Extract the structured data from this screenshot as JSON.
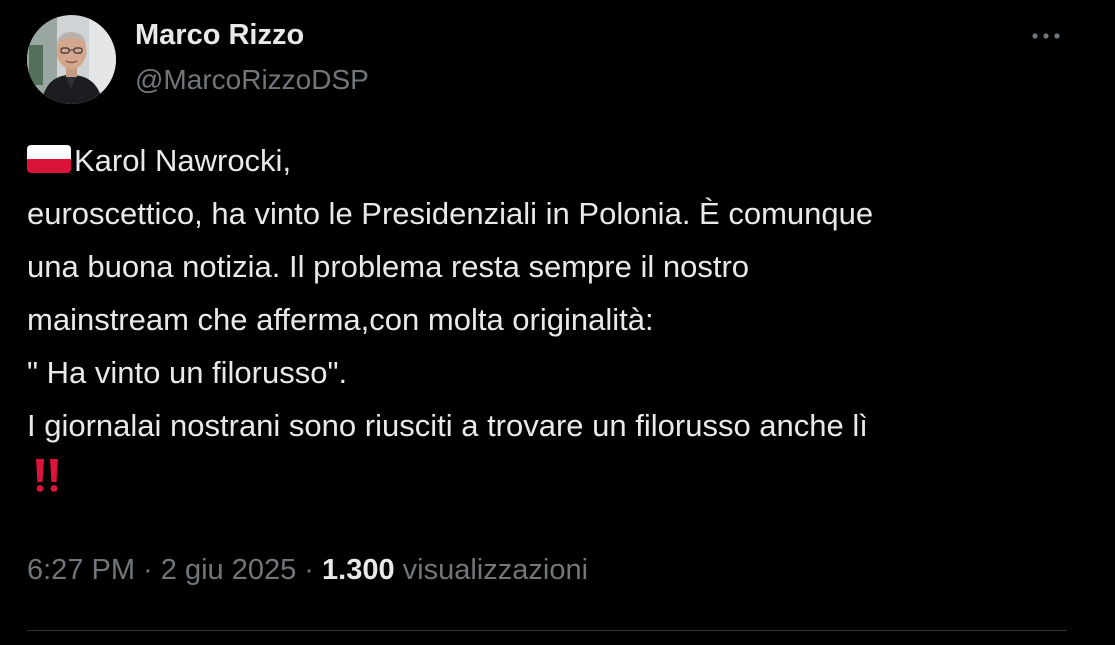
{
  "author": {
    "name": "Marco Rizzo",
    "handle": "@MarcoRizzoDSP",
    "avatar_icon": "profile-photo"
  },
  "more_icon": "more-horizontal-icon",
  "tweet": {
    "lines": [
      "Karol Nawrocki,",
      "euroscettico, ha vinto le Presidenziali in Polonia. È comunque",
      "una buona notizia. Il problema resta sempre il nostro",
      "mainstream che afferma,con molta originalità:",
      "\" Ha vinto un filorusso\".",
      "I giornalai nostrani sono riusciti a trovare un filorusso anche lì"
    ],
    "leading_emoji": "poland-flag-icon",
    "trailing_emoji": "double-exclamation-icon"
  },
  "meta": {
    "time": "6:27 PM",
    "sep1": " · ",
    "date": "2 giu 2025",
    "sep2": " · ",
    "views_count": "1.300",
    "views_label": " visualizzazioni"
  },
  "colors": {
    "background": "#000000",
    "text": "#e7e9ea",
    "secondary": "#71767b",
    "divider": "#2f3336",
    "emoji_red": "#dc143c"
  }
}
